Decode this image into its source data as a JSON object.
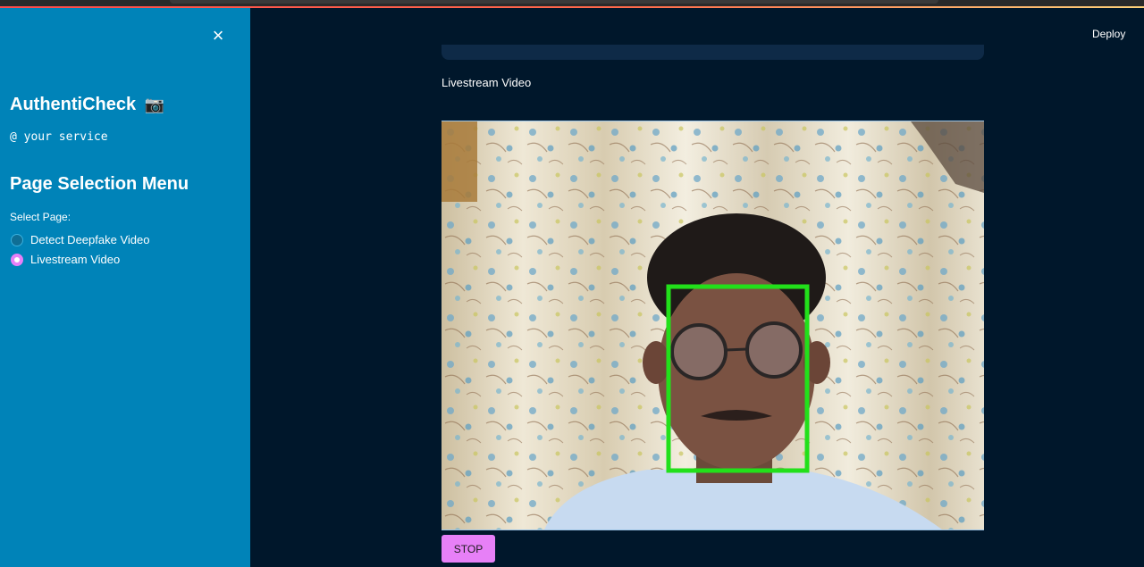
{
  "sidebar": {
    "close_label": "×",
    "app_title": "AuthentiCheck",
    "app_title_icon": "camera-icon",
    "app_subtitle": "@ your service",
    "menu_title": "Page Selection Menu",
    "select_label": "Select Page:",
    "options": [
      {
        "label": "Detect Deepfake Video",
        "selected": false
      },
      {
        "label": "Livestream Video",
        "selected": true
      }
    ]
  },
  "header": {
    "deploy_label": "Deploy"
  },
  "main": {
    "section_label": "Livestream Video",
    "stop_label": "STOP"
  },
  "colors": {
    "sidebar_bg": "#0083b8",
    "main_bg": "#00172b",
    "accent": "#e780f7",
    "face_box": "#22e01a"
  }
}
